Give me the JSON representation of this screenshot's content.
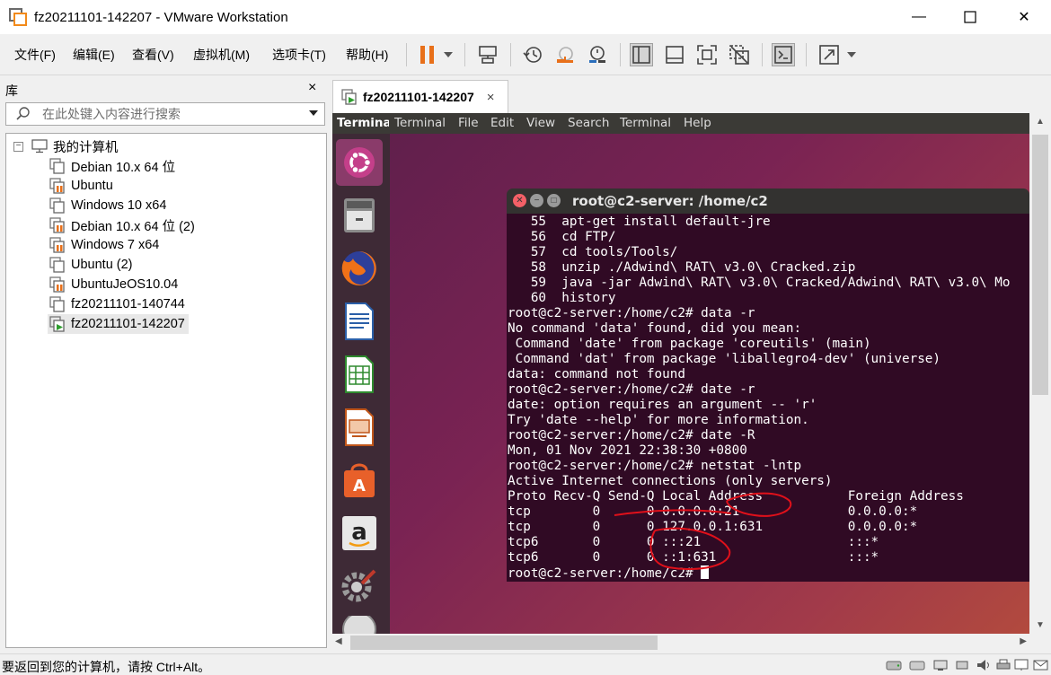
{
  "window": {
    "title": "fz20211101-142207 - VMware Workstation",
    "minimize_glyph": "—",
    "maximize_glyph": "☐",
    "close_glyph": "✕"
  },
  "menu": {
    "file": "文件(F)",
    "edit": "编辑(E)",
    "view": "查看(V)",
    "vm": "虚拟机(M)",
    "tabs": "选项卡(T)",
    "help": "帮助(H)"
  },
  "toolbar_icons": [
    "pause-icon",
    "dropdown-arrow-icon",
    "send-ctrl-alt-del-icon",
    "snapshot-icon",
    "revert-snapshot-icon",
    "snapshot-manager-icon",
    "show-library-icon",
    "thumbnail-bar-icon",
    "full-screen-icon",
    "unity-icon",
    "console-view-icon",
    "stretch-guest-icon"
  ],
  "library": {
    "title": "库",
    "close_glyph": "×",
    "search_placeholder": "在此处键入内容进行搜索",
    "root": "我的计算机",
    "items": [
      {
        "label": "Debian 10.x 64 位",
        "running": false
      },
      {
        "label": "Ubuntu",
        "running": false
      },
      {
        "label": "Windows 10 x64",
        "running": false
      },
      {
        "label": "Debian 10.x 64 位 (2)",
        "running": false
      },
      {
        "label": "Windows 7 x64",
        "running": false
      },
      {
        "label": "Ubuntu (2)",
        "running": false
      },
      {
        "label": "UbuntuJeOS10.04",
        "running": false
      },
      {
        "label": "fz20211101-140744",
        "running": false
      },
      {
        "label": "fz20211101-142207",
        "running": true
      }
    ]
  },
  "tab": {
    "label": "fz20211101-142207",
    "close_glyph": "×"
  },
  "guest": {
    "topbar": {
      "app": "Terminal",
      "menus": [
        "Terminal",
        "File",
        "Edit",
        "View",
        "Search",
        "Terminal",
        "Help"
      ]
    },
    "launcher": [
      "ubuntu-logo-icon",
      "file-manager-icon",
      "firefox-icon",
      "libreoffice-writer-icon",
      "libreoffice-calc-icon",
      "libreoffice-impress-icon",
      "software-center-icon",
      "amazon-icon",
      "system-settings-icon",
      "software-updater-icon"
    ],
    "terminal": {
      "title": "root@c2-server: /home/c2",
      "lines": [
        "   55  apt-get install default-jre",
        "   56  cd FTP/",
        "   57  cd tools/Tools/",
        "   58  unzip ./Adwind\\ RAT\\ v3.0\\ Cracked.zip",
        "   59  java -jar Adwind\\ RAT\\ v3.0\\ Cracked/Adwind\\ RAT\\ v3.0\\ Mo",
        "   60  history",
        "root@c2-server:/home/c2# data -r",
        "No command 'data' found, did you mean:",
        " Command 'date' from package 'coreutils' (main)",
        " Command 'dat' from package 'liballegro4-dev' (universe)",
        "data: command not found",
        "root@c2-server:/home/c2# date -r",
        "date: option requires an argument -- 'r'",
        "Try 'date --help' for more information.",
        "root@c2-server:/home/c2# date -R",
        "Mon, 01 Nov 2021 22:38:30 +0800",
        "root@c2-server:/home/c2# netstat -lntp",
        "Active Internet connections (only servers)",
        "Proto Recv-Q Send-Q Local Address           Foreign Address",
        "tcp        0      0 0.0.0.0:21              0.0.0.0:*",
        "tcp        0      0 127.0.0.1:631           0.0.0.0:*",
        "tcp6       0      0 :::21                   :::*",
        "tcp6       0      0 ::1:631                 :::*"
      ],
      "prompt": "root@c2-server:/home/c2# "
    }
  },
  "status": {
    "text": "要返回到您的计算机，请按 Ctrl+Alt。",
    "icons": [
      "hard-disk-icon",
      "cd-rom-icon",
      "network-icon",
      "usb-icon",
      "sound-icon",
      "printer-icon",
      "display-icon",
      "message-icon"
    ]
  },
  "colors": {
    "terminal_bg": "#300a24",
    "pause_orange": "#e8701a",
    "annotation_red": "#e0101a"
  }
}
